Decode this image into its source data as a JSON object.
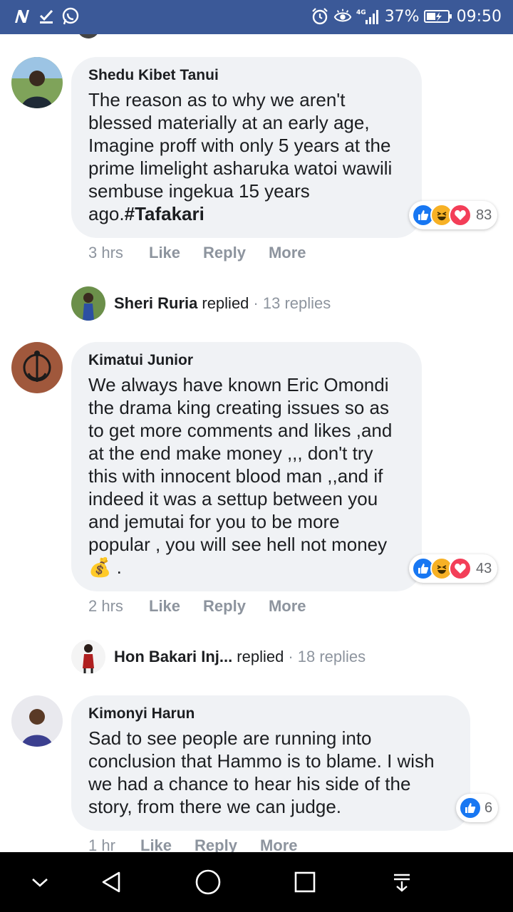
{
  "status_bar": {
    "left_icons": [
      "n-notification-icon",
      "download-check-icon",
      "whatsapp-icon"
    ],
    "network": "4G",
    "battery": "37%",
    "time": "09:50"
  },
  "comments": [
    {
      "author": "Shedu Kibet Tanui",
      "text": "The reason as to why we aren't blessed materially at an early age, Imagine proff with only 5 years at the prime limelight asharuka watoi wawili sembuse ingekua 15 years ago.",
      "hashtag": "#Tafakari",
      "reaction_count": "83",
      "time": "3 hrs",
      "actions": [
        "Like",
        "Reply",
        "More"
      ],
      "reply_summary": {
        "name": "Sheri Ruria",
        "verb": "replied",
        "count": "· 13 replies"
      }
    },
    {
      "author": "Kimatui Junior",
      "text": "We always have known Eric Omondi the drama king creating issues so as to get more comments and likes ,and at the end make money ,,, don't try this with innocent blood man ,,and if indeed it was a settup between you and jemutai for you to be more popular , you will see hell not money",
      "emoji": "💰",
      "suffix": " .",
      "reaction_count": "43",
      "time": "2 hrs",
      "actions": [
        "Like",
        "Reply",
        "More"
      ],
      "reply_summary": {
        "name": "Hon Bakari Inj...",
        "verb": "replied",
        "count": "· 18 replies"
      }
    },
    {
      "author": "Kimonyi Harun",
      "text": "Sad to see people are running into conclusion that Hammo is to blame. I wish we had a chance to hear his side of the story, from there we can judge.",
      "reaction_count": "6",
      "time": "1 hr",
      "actions": [
        "Like",
        "Reply",
        "More"
      ]
    }
  ],
  "colors": {
    "status_bar": "#3b5998",
    "bubble": "#f0f2f5",
    "like": "#1877f2",
    "love": "#f33e58",
    "haha": "#f7b125",
    "muted": "#8d949e"
  },
  "nav_bar": [
    "chevron-down-icon",
    "back-triangle-icon",
    "home-circle-icon",
    "recents-square-icon",
    "notification-pull-icon"
  ]
}
